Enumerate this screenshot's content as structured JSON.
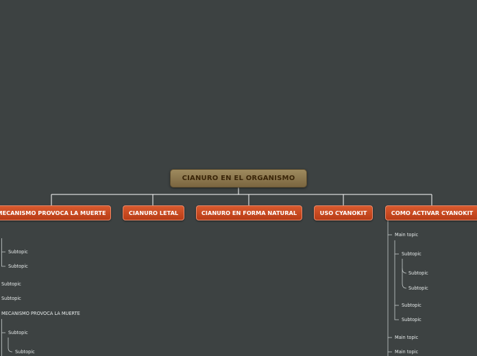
{
  "root": {
    "label": "CIANURO EN EL ORGANISMO"
  },
  "main_topics": [
    "MECANISMO PROVOCA LA MUERTE",
    "CIANURO LETAL",
    "CIANURO EN FORMA NATURAL",
    "USO CYANOKIT",
    "COMO ACTIVAR CYANOKIT"
  ],
  "left_branch": {
    "items": [
      "Subtopic",
      "Subtopic",
      "Subtopic",
      "Subtopic",
      "MECANISMO PROVOCA LA MUERTE",
      "Subtopic",
      "Subtopic"
    ]
  },
  "right_branch": {
    "items": [
      "Main topic",
      "Subtopic",
      "Subtopic",
      "Subtopic",
      "Subtopic",
      "Subtopic",
      "Main topic",
      "Main topic"
    ]
  },
  "colors": {
    "background": "#3d4242",
    "root_fill": "#8c7750",
    "root_text": "#3a2508",
    "main_fill": "#c8481f",
    "connector": "#ffffff"
  }
}
